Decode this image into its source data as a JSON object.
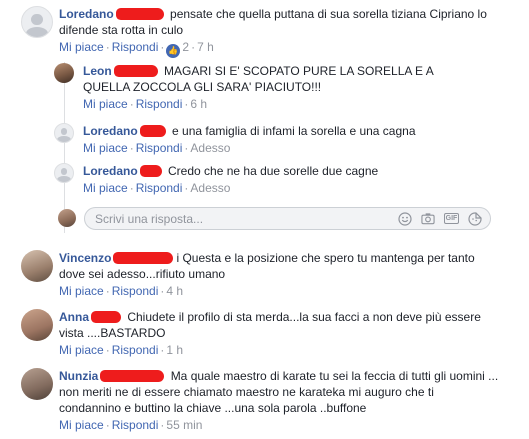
{
  "comments": [
    {
      "name": "Loredano",
      "text": "pensate che quella puttana di sua sorella tiziana Cipriano lo difende sta rotta in culo",
      "like": "Mi piace",
      "reply": "Rispondi",
      "reactions": "2",
      "time": "7 h"
    },
    {
      "name": "Leon",
      "text": "MAGARI SI E' SCOPATO PURE LA SORELLA E A QUELLA ZOCCOLA GLI SARA' PIACIUTO!!!",
      "like": "Mi piace",
      "reply": "Rispondi",
      "time": "6 h"
    },
    {
      "name": "Loredano",
      "text": "e una famiglia di infami la sorella e una cagna",
      "like": "Mi piace",
      "reply": "Rispondi",
      "time": "Adesso"
    },
    {
      "name": "Loredano",
      "text": "Credo che ne ha due sorelle due cagne",
      "like": "Mi piace",
      "reply": "Rispondi",
      "time": "Adesso"
    },
    {
      "name": "Vincenzo",
      "text": "i Questa e la posizione che spero tu mantenga per tanto dove sei adesso...rifiuto umano",
      "like": "Mi piace",
      "reply": "Rispondi",
      "time": "4 h"
    },
    {
      "name": "Anna",
      "text": "Chiudete il profilo di sta merda...la sua facci a non deve più essere vista ....BASTARDO",
      "like": "Mi piace",
      "reply": "Rispondi",
      "time": "1 h"
    },
    {
      "name": "Nunzia",
      "text": "Ma quale maestro di karate tu sei la feccia di tutti gli uomini ... non meriti ne di essere chiamato maestro ne karateka mi auguro che ti condannino e buttino la chiave ...una sola parola ..buffone",
      "like": "Mi piace",
      "reply": "Rispondi",
      "time": "55 min"
    }
  ],
  "reply_box": {
    "placeholder": "Scrivi una risposta...",
    "icons": [
      "smiley-icon",
      "camera-icon",
      "gif-icon",
      "sticker-icon"
    ]
  },
  "colors": {
    "name": "#365899",
    "link": "#4267b2",
    "meta": "#90949c",
    "redaction": "#ee1c1c"
  }
}
